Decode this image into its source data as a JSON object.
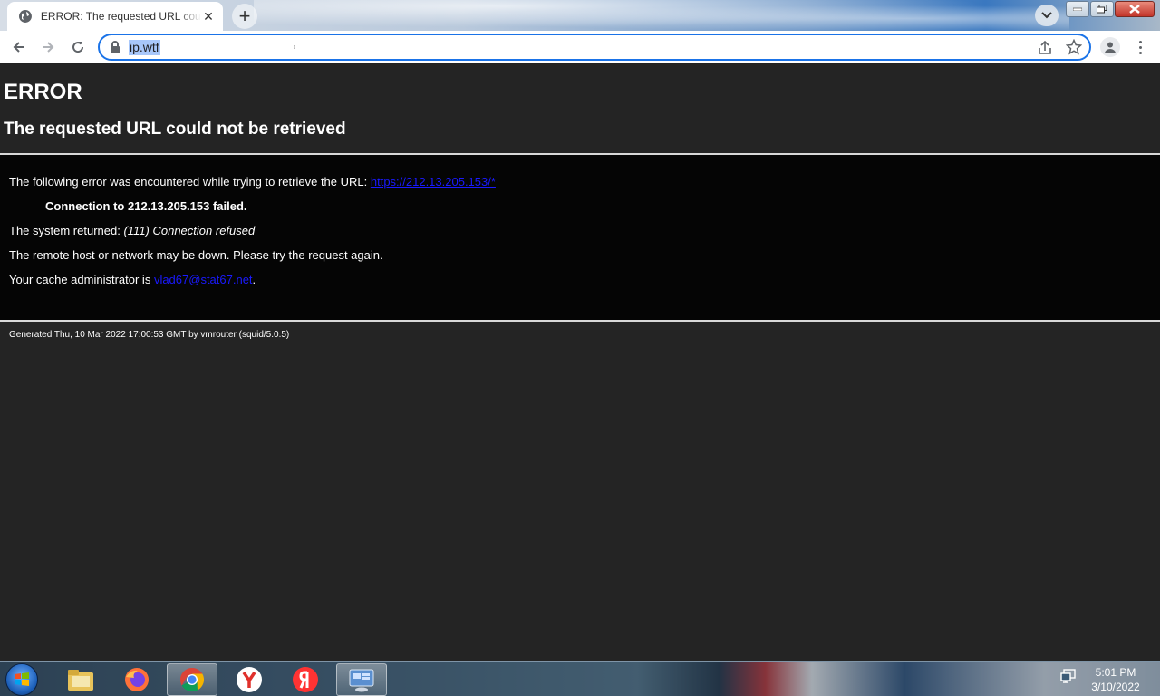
{
  "browser": {
    "tab": {
      "title": "ERROR: The requested URL could not be retrieved",
      "close_icon": "close-icon",
      "favicon": "globe-icon"
    },
    "new_tab_icon": "plus-icon",
    "address_bar": {
      "url": "ip.wtf",
      "lock_icon": "lock-icon"
    },
    "accent_color": "#1a73e8"
  },
  "page": {
    "heading": "ERROR",
    "subheading": "The requested URL could not be retrieved",
    "error_intro": "The following error was encountered while trying to retrieve the URL: ",
    "error_url": "https://212.13.205.153/*",
    "failure_message": "Connection to 212.13.205.153 failed.",
    "system_returned_label": "The system returned: ",
    "system_returned_value": "(111) Connection refused",
    "remote_host_message": "The remote host or network may be down. Please try the request again.",
    "cache_admin_label": "Your cache administrator is ",
    "cache_admin_email": "vlad67@stat67.net",
    "cache_admin_suffix": ".",
    "footer": "Generated Thu, 10 Mar 2022 17:00:53 GMT by vmrouter (squid/5.0.5)"
  },
  "taskbar": {
    "items": [
      "start-button",
      "file-explorer",
      "firefox",
      "chrome",
      "yandex-browser",
      "yandex",
      "remote-desktop"
    ],
    "clock_time": "5:01 PM",
    "clock_date": "3/10/2022"
  }
}
